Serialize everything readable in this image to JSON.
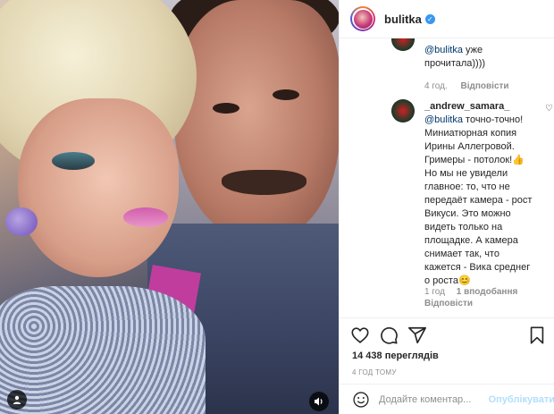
{
  "post": {
    "username": "bulitka",
    "verified": true
  },
  "comments": [
    {
      "line1_mention": "@bulitka",
      "line1_text": " уже",
      "line2": "прочитала))))",
      "time": "4 год.",
      "reply": "Відповісти"
    },
    {
      "username": "_andrew_samara_",
      "mention": "@bulitka",
      "lines": [
        " точно-точно!",
        "Миниатюрная копия",
        "Ирины Аллегровой.",
        "Гримеры - потолок!👍",
        "Но мы не увидели",
        "главное: то, что не",
        "передаёт камера - рост",
        "Викуси. Это можно",
        "видеть только на",
        "площадке. А камера",
        "снимает так, что",
        "кажется - Вика среднег",
        "о роста😊"
      ],
      "time": "1 год",
      "likes": "1 вподобання",
      "reply": "Відповісти"
    }
  ],
  "stats": {
    "views": "14 438 переглядів",
    "posted": "4 ГОД ТОМУ"
  },
  "comment_box": {
    "placeholder": "Додайте коментар...",
    "publish": "Опублікувати"
  },
  "icons": {
    "like": "heart-icon",
    "comment": "comment-icon",
    "share": "share-icon",
    "save": "bookmark-icon",
    "emoji": "emoji-icon",
    "tagged_users": "user-tag-icon",
    "sound": "sound-icon"
  },
  "colors": {
    "mention": "#00376b",
    "verified": "#3897f0",
    "publish": "#b2dffc",
    "meta": "#8e8e8e"
  }
}
